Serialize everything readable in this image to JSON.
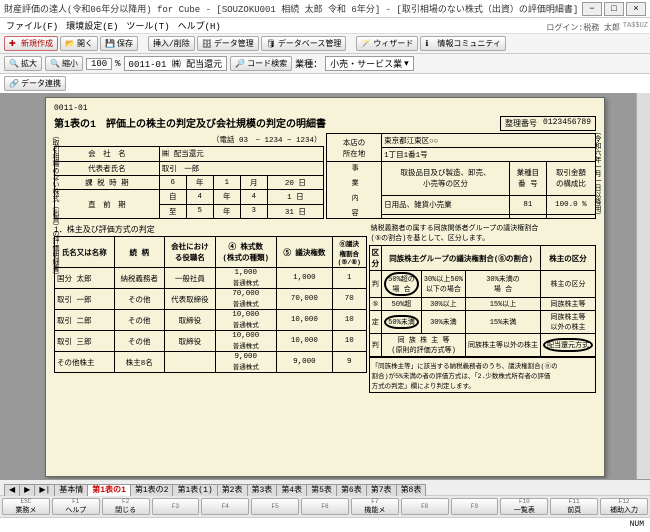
{
  "window": {
    "title": "財産評価の達人(令和06年分以降用) for Cube - [SOUZOKU001 相続 太郎 令和 6年分] - [取引相場のない株式（出資）の評価明細書]",
    "min": "−",
    "max": "□",
    "close": "×"
  },
  "menu": [
    "ファイル(F)",
    "環境設定(E)",
    "ツール(T)",
    "ヘルプ(H)"
  ],
  "toolbar": {
    "new": "新規作成",
    "open": "開く",
    "save": "保存",
    "insdel": "挿入/削除",
    "datamgr": "データ管理",
    "dbmgr": "データベース管理",
    "wizard": "ウィザード",
    "community": "情報コミュニティ"
  },
  "login": "ログイン:税務 太郎",
  "brand": "TA$$UZ",
  "toolbar2": {
    "zoomin": "拡大",
    "zoomout": "縮小",
    "zoom": "100",
    "pct": "%",
    "code": "0011-01 ㈱ 配当還元",
    "codesearch": "コード検索",
    "biztype_lbl": "業種：",
    "biztype": "小売・サービス業"
  },
  "datalink": "データ連携",
  "page": {
    "code": "0011-01",
    "title": "第1表の1　評価上の株主の判定及び会社規模の判定の明細書",
    "reg_lbl": "整理番号",
    "reg_no": "0123456789",
    "sidebar_l": "（取引相場のない株式（出資）の評価明細書）",
    "sidebar_r": "（令和六年一月一日以降用）",
    "tel_lbl": "（電話 03　− 1234 − 1234）",
    "company_lbl": "会　社　名",
    "company": "㈱ 配当還元",
    "rep_lbl": "代表者氏名",
    "rep": "取引　一郎",
    "loc_lbl": "本店の\n所在地",
    "loc1": "東京都江東区○○",
    "loc2": "1丁目1番1号",
    "biz_lbl": "取扱品目及び製造、卸売、\n小売等の区分",
    "biz_cat_lbl": "業種目\n番 号",
    "biz_ratio_lbl": "取引金額\nの構成比",
    "biz_item": "日用品、雑貨小売業",
    "biz_no": "81",
    "biz_ratio": "100.0 %",
    "biz_side": "事\n業\n内\n容",
    "tax_lbl": "課 税 時 期",
    "tax_y": "6",
    "tax_m": "1",
    "tax_d": "20",
    "tax_u": [
      "年",
      "月",
      "日"
    ],
    "prev_lbl": "直　前　期",
    "prev_from": "自",
    "prev_fy": "4",
    "prev_fm": "4",
    "prev_fd": "1",
    "prev_to": "至",
    "prev_ty": "5",
    "prev_tm": "3",
    "prev_td": "31",
    "sec1": "1．株主及び評価方式の判定",
    "note1a": "納税義務者の属する同族関係者グループの議決権割合",
    "note1b": "(⑤の割合)を基として、区分します。",
    "cols": {
      "name": "氏名又は名称",
      "rel": "続 柄",
      "role": "会社におけ\nる役職名",
      "shares": "④ 株式数\n(株式の種類)",
      "votes": "⑤ 議決権数",
      "vratio": "⑥議決\n権割合\n(⑤/⑧)",
      "class": "区\n分",
      "group": "同族株主グループの議決権割合(⑥の割合)",
      "sh_class": "株主の区分"
    },
    "side_labels": {
      "hantei": "判\n定\n要\n素",
      "kabu": "課\n税",
      "zei": "時"
    },
    "rows": [
      {
        "name": "国分 太郎",
        "rel": "納税義務者",
        "role": "一般社員",
        "t1": "1,000",
        "t2": "普通株式",
        "v": "1,000",
        "r": "1"
      },
      {
        "name": "取引 一郎",
        "rel": "その他",
        "role": "代表取締役",
        "t1": "70,000",
        "t2": "普通株式",
        "v": "70,000",
        "r": "70"
      },
      {
        "name": "取引 二郎",
        "rel": "その他",
        "role": "取締役",
        "t1": "10,000",
        "t2": "普通株式",
        "v": "10,000",
        "r": "10"
      },
      {
        "name": "取引 三郎",
        "rel": "その他",
        "role": "取締役",
        "t1": "10,000",
        "t2": "普通株式",
        "v": "10,000",
        "r": "10"
      },
      {
        "name": "その他株主",
        "rel": "株主8名",
        "role": "",
        "t1": "9,000",
        "t2": "普通株式",
        "v": "9,000",
        "r": "9"
      }
    ],
    "grid": [
      [
        "判",
        "50%超の\n場 合",
        "30%以上50%\n以下の場合",
        "30%未満の\n場 合",
        "株主の区分"
      ],
      [
        "⑤",
        "50%超",
        "30%以上",
        "15%以上",
        "同族株主等"
      ],
      [
        "定",
        "50%未満",
        "30%未満",
        "15%未満",
        "同族株主等\n以外の株主"
      ],
      [
        "判",
        "同 族 株 主 等\n(原則的評価方式等)",
        "",
        "同族株主等以外の株主",
        "配当還元方式"
      ]
    ],
    "circ1": "50%超の",
    "circ2": "50%未満",
    "circ3": "配当還元方式",
    "footnote": "「同族株主等」に該当する納税義務者のうち、議決権割合(⑥の\n割合)が5%未満の者の評価方式は、「2.少数株式所有者の評価\n方式の判定」欄により判定します。"
  },
  "tabs": [
    "基本情",
    "第1表の1",
    "第1表の2",
    "第1表(1)",
    "第2表",
    "第3表",
    "第4表",
    "第5表",
    "第6表",
    "第7表",
    "第8表"
  ],
  "tabs_nav": [
    "◀",
    "▶",
    "▶|"
  ],
  "fkeys": [
    {
      "f": "ESC",
      "l": "業務メ"
    },
    {
      "f": "F1",
      "l": "ヘルプ"
    },
    {
      "f": "F2",
      "l": "閉じる"
    },
    {
      "f": "F3",
      "l": ""
    },
    {
      "f": "F4",
      "l": ""
    },
    {
      "f": "F5",
      "l": ""
    },
    {
      "f": "F6",
      "l": ""
    },
    {
      "f": "F7",
      "l": "機能メ"
    },
    {
      "f": "F8",
      "l": ""
    },
    {
      "f": "F9",
      "l": ""
    },
    {
      "f": "F10",
      "l": "一覧表"
    },
    {
      "f": "F11",
      "l": "前頁"
    },
    {
      "f": "F12",
      "l": "補助入力"
    }
  ],
  "status": "NUM"
}
